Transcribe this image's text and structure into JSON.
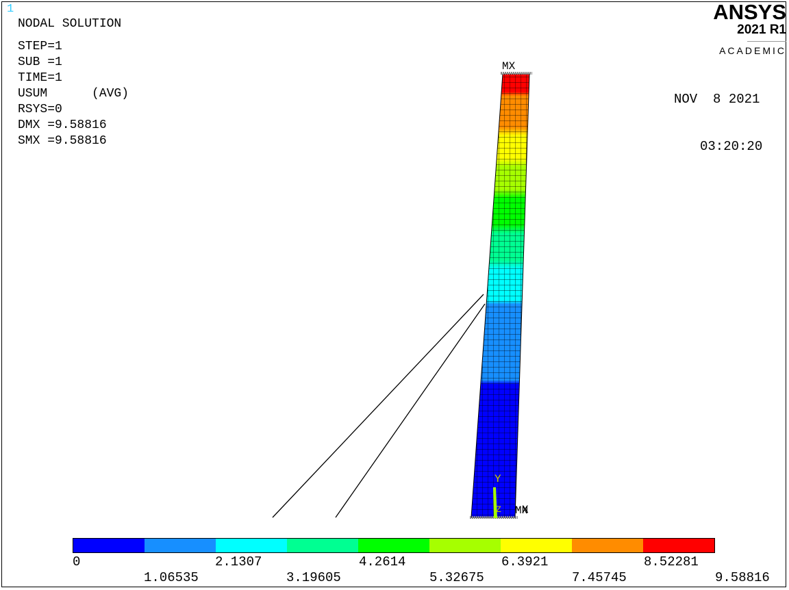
{
  "window_number": "1",
  "solution": {
    "title": "NODAL SOLUTION",
    "rows": [
      {
        "text": "STEP=1"
      },
      {
        "text": "SUB =1"
      },
      {
        "text": "TIME=1"
      },
      {
        "text": "USUM      (AVG)"
      },
      {
        "text": "RSYS=0"
      },
      {
        "text": "DMX =9.58816"
      },
      {
        "text": "SMX =9.58816"
      }
    ]
  },
  "logo": {
    "brand": "ANSYS",
    "version": "2021 R1",
    "edition": "ACADEMIC"
  },
  "datetime": {
    "date": "NOV  8 2021",
    "time": "03:20:20"
  },
  "markers": {
    "max": "MX",
    "min": "MN",
    "axis_y": "Y",
    "axis_x": "X",
    "axis_z": "Z"
  },
  "legend": {
    "colors": [
      "#0000ff",
      "#178fff",
      "#00ffff",
      "#00ff92",
      "#00ff00",
      "#a6ff00",
      "#ffff00",
      "#ff8c00",
      "#ff0000"
    ],
    "labels_top": [
      "0",
      "2.1307",
      "4.2614",
      "6.3921",
      "8.52281"
    ],
    "labels_bottom": [
      "1.06535",
      "3.19605",
      "5.32675",
      "7.45745",
      "9.58816"
    ]
  }
}
